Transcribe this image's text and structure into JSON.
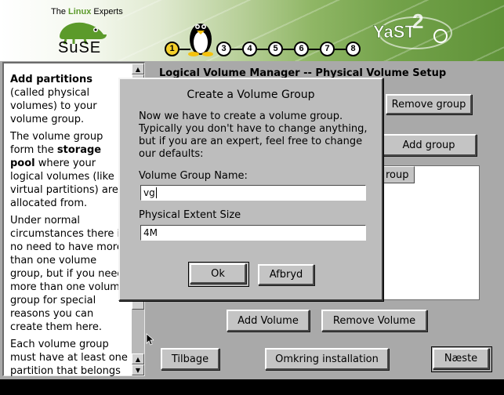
{
  "header": {
    "tagline_prefix": "The ",
    "tagline_highlight": "Linux",
    "tagline_suffix": " Experts",
    "brand": "SuSE",
    "product": "YaST2",
    "steps": [
      "1",
      "2",
      "3",
      "4",
      "5",
      "6",
      "7",
      "8"
    ],
    "active_step": "1",
    "accent_color": "#5b9a2a"
  },
  "help": {
    "p1_bold": "Add partitions",
    "p1_rest": " (called physical volumes) to your volume group.",
    "p2_a": "The volume group form the ",
    "p2_bold": "storage pool",
    "p2_b": " where your logical volumes (like virtual partitions) are allocated from.",
    "p3": "Under normal circumstances there is no need to have more than one volume group, but if you need more than one volume group for special reasons you can create them here.",
    "p4": "Each volume group must have at least one partition that belongs to it."
  },
  "main": {
    "title": "Logical Volume Manager -- Physical Volume Setup",
    "remove_group": "Remove group",
    "add_group": "Add group",
    "table_header": "roup",
    "add_volume": "Add Volume",
    "remove_volume": "Remove Volume"
  },
  "footer": {
    "back": "Tilbage",
    "about": "Omkring installation",
    "next": "Næste"
  },
  "dialog": {
    "title": "Create a Volume Group",
    "description": "Now we have to create a volume group. Typically you don't have to change anything, but if you are an expert, feel free to change our defaults:",
    "vg_name_label": "Volume Group Name:",
    "vg_name_value": "vg",
    "pe_size_label": "Physical Extent Size",
    "pe_size_value": "4M",
    "ok": "Ok",
    "cancel": "Afbryd"
  }
}
